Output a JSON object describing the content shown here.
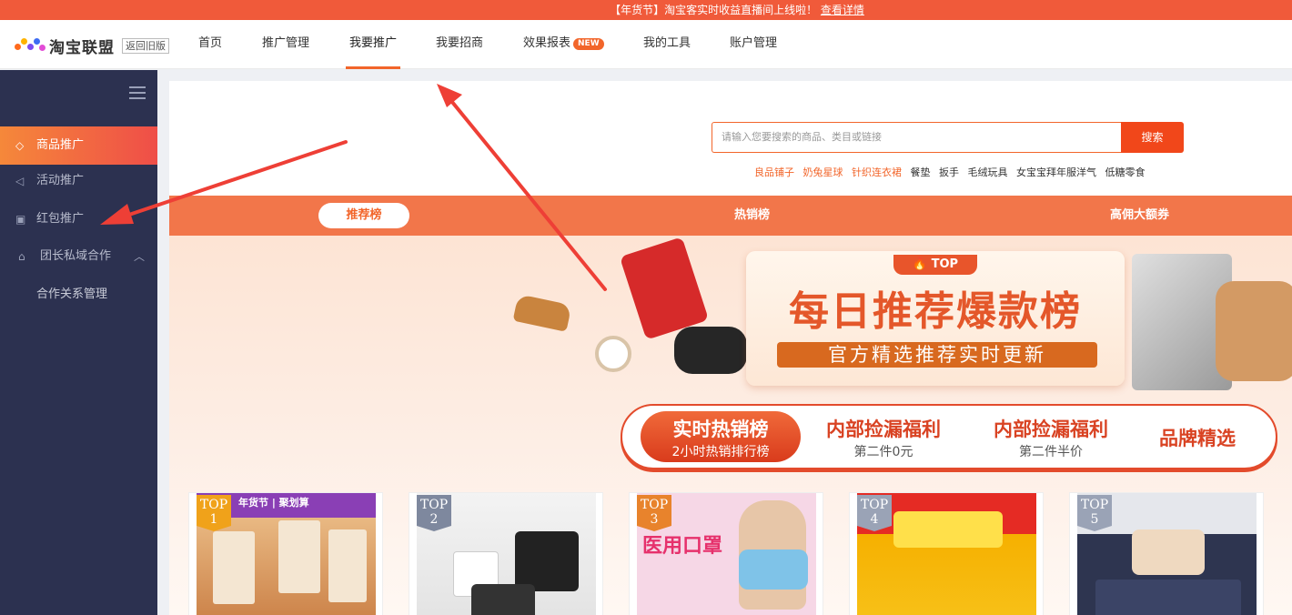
{
  "notice": {
    "text": "【年货节】淘宝客实时收益直播间上线啦！",
    "link": "查看详情"
  },
  "brand": {
    "name": "淘宝联盟",
    "old_version": "返回旧版"
  },
  "nav": [
    {
      "label": "首页"
    },
    {
      "label": "推广管理"
    },
    {
      "label": "我要推广",
      "active": true
    },
    {
      "label": "我要招商"
    },
    {
      "label": "效果报表",
      "badge": "NEW"
    },
    {
      "label": "我的工具"
    },
    {
      "label": "账户管理"
    }
  ],
  "sidebar": {
    "items": [
      {
        "label": "商品推广",
        "icon": "tag-icon",
        "active": true
      },
      {
        "label": "活动推广",
        "icon": "megaphone-icon"
      },
      {
        "label": "红包推广",
        "icon": "red-packet-icon"
      },
      {
        "label": "团长私域合作",
        "icon": "lock-icon",
        "expanded": true
      }
    ],
    "sub_items": [
      {
        "label": "合作关系管理"
      }
    ]
  },
  "search": {
    "placeholder": "请输入您要搜索的商品、类目或链接",
    "button": "搜索"
  },
  "hot_words": [
    {
      "text": "良品铺子",
      "hot": true
    },
    {
      "text": "奶兔星球",
      "hot": true
    },
    {
      "text": "针织连衣裙",
      "hot": true
    },
    {
      "text": "餐垫",
      "hot": false
    },
    {
      "text": "扳手",
      "hot": false
    },
    {
      "text": "毛绒玩具",
      "hot": false
    },
    {
      "text": "女宝宝拜年服洋气",
      "hot": false
    },
    {
      "text": "低糖零食",
      "hot": false
    }
  ],
  "rank_tabs": [
    {
      "label": "推荐榜",
      "active": true
    },
    {
      "label": "热销榜"
    },
    {
      "label": "高佣大额券"
    }
  ],
  "banner": {
    "top_label": "TOP",
    "title": "每日推荐爆款榜",
    "subtitle": "官方精选推荐实时更新"
  },
  "categories": [
    {
      "title": "实时热销榜",
      "sub": "2小时热销排行榜",
      "active": true
    },
    {
      "title": "内部捡漏福利",
      "sub": "第二件0元"
    },
    {
      "title": "内部捡漏福利",
      "sub": "第二件半价"
    },
    {
      "title": "品牌精选",
      "sub": ""
    }
  ],
  "products": [
    {
      "rank": "TOP",
      "num": "1",
      "tag_color": "#f0a21a",
      "caption": "年货节 | 聚划算"
    },
    {
      "rank": "TOP",
      "num": "2",
      "tag_color": "#7e889e"
    },
    {
      "rank": "TOP",
      "num": "3",
      "tag_color": "#e8832c",
      "caption": "医用口罩"
    },
    {
      "rank": "TOP",
      "num": "4",
      "tag_color": "#9aa3b6"
    },
    {
      "rank": "TOP",
      "num": "5",
      "tag_color": "#9aa3b6"
    }
  ],
  "colors": {
    "accent": "#f2652a",
    "sidebar": "#2c3150",
    "notice": "#f05a3a"
  }
}
